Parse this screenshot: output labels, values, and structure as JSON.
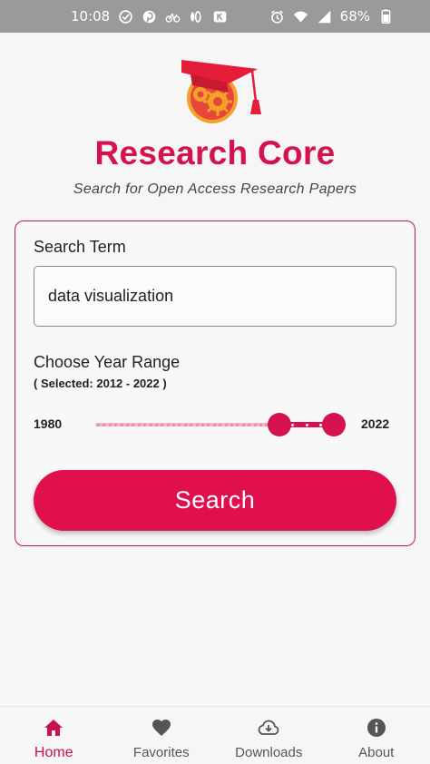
{
  "status_bar": {
    "time": "10:08",
    "battery": "68%",
    "left_icons": [
      "check-circle-icon",
      "pinterest-icon",
      "bicycle-icon",
      "app-icon",
      "k-icon"
    ],
    "right_icons": [
      "alarm-icon",
      "wifi-icon",
      "signal-icon",
      "battery-icon"
    ]
  },
  "header": {
    "title": "Research Core",
    "subtitle": "Search for Open Access Research Papers",
    "logo": "graduation-cap-gears-logo"
  },
  "form": {
    "search_term_label": "Search Term",
    "search_term_value": "data visualization",
    "year_range_label": "Choose Year Range",
    "year_range_selected": "( Selected: 2012 - 2022 )",
    "range_min_label": "1980",
    "range_max_label": "2022",
    "range": {
      "min": 1980,
      "max": 2022,
      "selected_start": 2012,
      "selected_end": 2022
    },
    "search_button_label": "Search"
  },
  "bottom_nav": {
    "items": [
      {
        "label": "Home",
        "icon": "home-icon",
        "active": true
      },
      {
        "label": "Favorites",
        "icon": "heart-icon",
        "active": false
      },
      {
        "label": "Downloads",
        "icon": "cloud-download-icon",
        "active": false
      },
      {
        "label": "About",
        "icon": "info-icon",
        "active": false
      }
    ]
  },
  "colors": {
    "accent": "#d5124d",
    "button": "#e0104f",
    "status_bar": "#9a9a9a"
  }
}
